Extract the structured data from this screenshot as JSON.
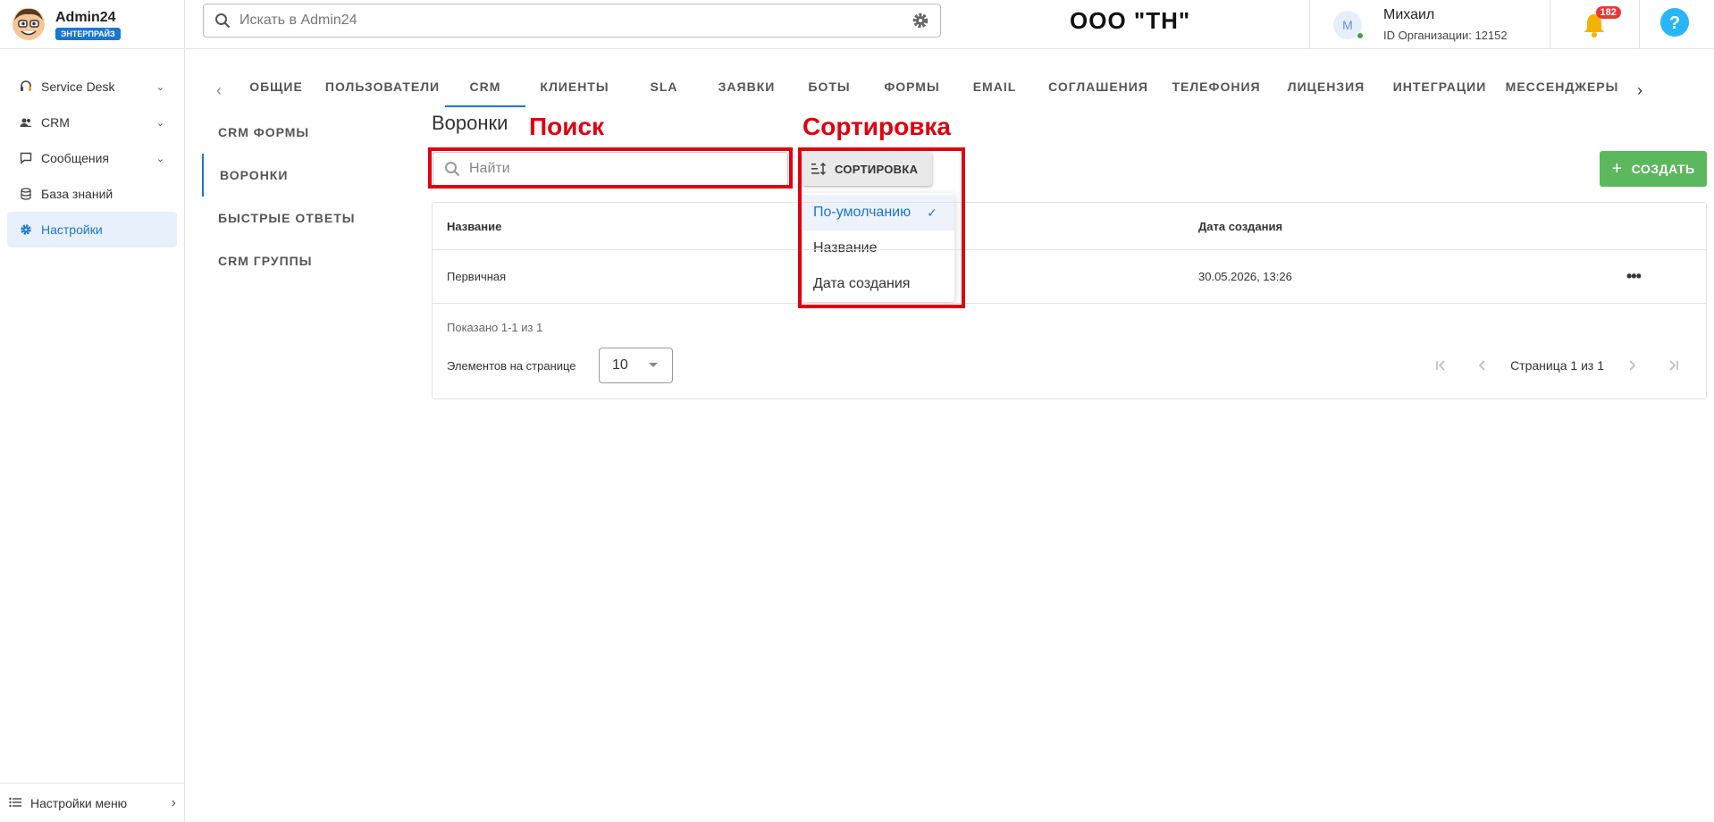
{
  "app": {
    "brand_name": "Admin24",
    "brand_badge": "ЭНТЕРПРАЙЗ"
  },
  "sidebar": {
    "items": [
      {
        "label": "Service Desk",
        "icon": "headset-icon",
        "has_chevron": true
      },
      {
        "label": "CRM",
        "icon": "people-icon",
        "has_chevron": true
      },
      {
        "label": "Сообщения",
        "icon": "message-icon",
        "has_chevron": true
      },
      {
        "label": "База знаний",
        "icon": "database-icon",
        "has_chevron": false
      },
      {
        "label": "Настройки",
        "icon": "gear-icon",
        "has_chevron": false,
        "active": true
      }
    ],
    "footer_label": "Настройки меню"
  },
  "header": {
    "search_placeholder": "Искать в Admin24",
    "org_title": "ООО \"ТН\"",
    "user_initial": "М",
    "user_name": "Михаил",
    "user_org_id": "ID Организации: 12152",
    "notifications_count": "182"
  },
  "tabs": [
    {
      "label": "ОБЩИЕ"
    },
    {
      "label": "ПОЛЬЗОВАТЕЛИ"
    },
    {
      "label": "CRM",
      "active": true
    },
    {
      "label": "КЛИЕНТЫ"
    },
    {
      "label": "SLA"
    },
    {
      "label": "ЗАЯВКИ"
    },
    {
      "label": "БОТЫ"
    },
    {
      "label": "ФОРМЫ"
    },
    {
      "label": "EMAIL"
    },
    {
      "label": "СОГЛАШЕНИЯ"
    },
    {
      "label": "ТЕЛЕФОНИЯ"
    },
    {
      "label": "ЛИЦЕНЗИЯ"
    },
    {
      "label": "ИНТЕГРАЦИИ"
    },
    {
      "label": "МЕССЕНДЖЕРЫ"
    }
  ],
  "subnav": [
    {
      "label": "CRM ФОРМЫ"
    },
    {
      "label": "ВОРОНКИ",
      "active": true
    },
    {
      "label": "БЫСТРЫЕ ОТВЕТЫ"
    },
    {
      "label": "CRM ГРУППЫ"
    }
  ],
  "main": {
    "title": "Воронки",
    "search_placeholder": "Найти",
    "sort_label": "СОРТИРОВКА",
    "create_label": "СОЗДАТЬ",
    "sort_options": [
      {
        "label": "По-умолчанию",
        "selected": true
      },
      {
        "label": "Название"
      },
      {
        "label": "Дата создания"
      }
    ],
    "table": {
      "columns": [
        "Название",
        "Дата создания"
      ],
      "rows": [
        {
          "name": "Первичная",
          "date": "30.05.2026, 13:26"
        }
      ]
    },
    "shown_text": "Показано 1-1 из 1",
    "per_page_label": "Элементов на странице",
    "per_page_value": "10",
    "page_text": "Страница 1 из 1"
  },
  "annotations": {
    "search_label": "Поиск",
    "sort_label": "Сортировка",
    "color": "#e0000f"
  },
  "colors": {
    "accent": "#1976d2",
    "create_button": "#5cb85c",
    "notification_badge": "#e53935"
  }
}
